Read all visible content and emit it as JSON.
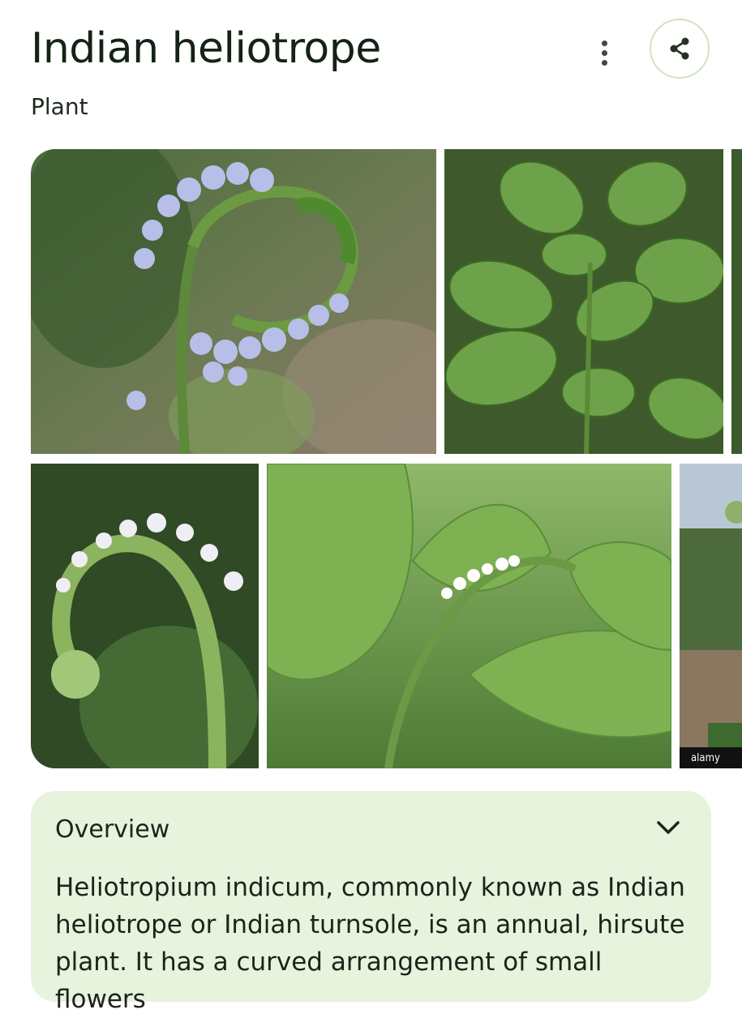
{
  "header": {
    "title": "Indian heliotrope",
    "subtitle": "Plant"
  },
  "icons": {
    "more": "more-vertical-icon",
    "share": "share-icon",
    "expand": "chevron-down-icon"
  },
  "gallery": {
    "images": [
      {
        "label": "curled flower spike with lilac flowers"
      },
      {
        "label": "plant with broad hairy leaves"
      },
      {
        "label": "curved hairy flower spike close-up"
      },
      {
        "label": "leaves with small white flower cluster"
      },
      {
        "label": "partial image",
        "watermark": "alamy"
      }
    ]
  },
  "overview": {
    "heading": "Overview",
    "text": "Heliotropium indicum, commonly known as Indian heliotrope or Indian turnsole, is an annual, hirsute plant. It has a curved arrangement of small flowers"
  },
  "colors": {
    "title": "#142314",
    "card_bg": "#e7f3dd",
    "share_ring": "#cfe3c7"
  }
}
